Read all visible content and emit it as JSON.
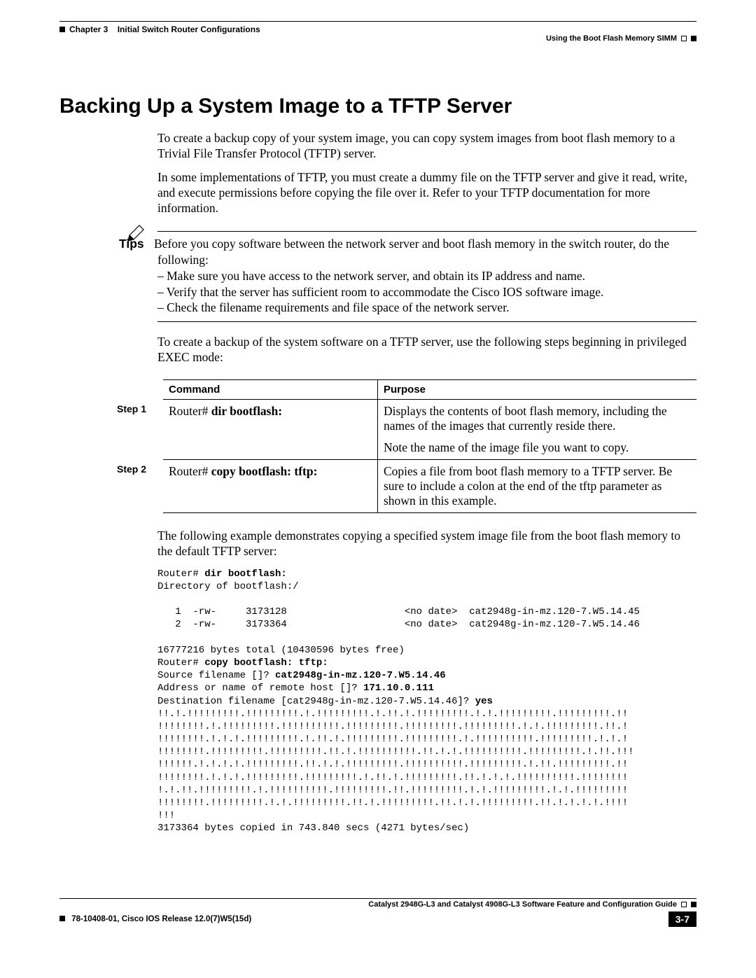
{
  "header": {
    "chapter": "Chapter 3",
    "chapter_title": "Initial Switch Router Configurations",
    "section": "Using the Boot Flash Memory SIMM"
  },
  "title": "Backing Up a System Image to a TFTP Server",
  "paras": {
    "p1": "To create a backup copy of your system image, you can copy system images from boot flash memory to a Trivial File Transfer Protocol (TFTP) server.",
    "p2": "In some implementations of TFTP, you must create a dummy file on the TFTP server and give it read, write, and execute permissions before copying the file over it. Refer to your TFTP documentation for more information.",
    "p3": "To create a backup of the system software on a TFTP server, use the following steps beginning in privileged EXEC mode:",
    "p4": "The following example demonstrates copying a specified system image file from the boot flash memory to the default TFTP server:"
  },
  "tips": {
    "label": "Tips",
    "intro": "Before you copy software between the network server and boot flash memory in the switch router, do the following:",
    "b1": "– Make sure you have access to the network server, and obtain its IP address and name.",
    "b2": "– Verify that the server has sufficient room to accommodate the Cisco IOS software image.",
    "b3": "– Check the filename requirements and file space of the network server."
  },
  "table": {
    "head_cmd": "Command",
    "head_purpose": "Purpose",
    "step1_label": "Step 1",
    "step1_prompt": "Router# ",
    "step1_cmd": "dir bootflash:",
    "step1_purpose_a": "Displays the contents of boot flash memory, including the names of the images that currently reside there.",
    "step1_purpose_b": "Note the name of the image file you want to copy.",
    "step2_label": "Step 2",
    "step2_prompt": "Router# ",
    "step2_cmd": "copy bootflash: tftp:",
    "step2_purpose": "Copies a file from boot flash memory to a TFTP server. Be sure to include a colon at the end of the tftp parameter as shown in this example."
  },
  "code": {
    "l1p": "Router# ",
    "l1b": "dir bootflash:",
    "l2": "Directory of bootflash:/",
    "l3": "",
    "l4": "   1  -rw-     3173128                    <no date>  cat2948g-in-mz.120-7.W5.14.45",
    "l5": "   2  -rw-     3173364                    <no date>  cat2948g-in-mz.120-7.W5.14.46",
    "l6": "",
    "l7": "16777216 bytes total (10430596 bytes free)",
    "l8p": "Router# ",
    "l8b": "copy bootflash: tftp:",
    "l9p": "Source filename []? ",
    "l9b": "cat2948g-in-mz.120-7.W5.14.46",
    "l10p": "Address or name of remote host []? ",
    "l10b": "171.10.0.111",
    "l11p": "Destination filename [cat2948g-in-mz.120-7.W5.14.46]? ",
    "l11b": "yes",
    "l12": "!!.!.!!!!!!!!!.!!!!!!!!!.!.!!!!!!!!!.!.!!.!.!!!!!!!!!.!.!.!!!!!!!!!.!!!!!!!!!.!!",
    "l13": "!!!!!!!!.!.!!!!!!!!!.!!!!!!!!!!.!!!!!!!!!.!!!!!!!!!.!!!!!!!!!.!.!.!!!!!!!!!.!!.!",
    "l14": "!!!!!!!!.!.!.!.!!!!!!!!!.!.!!.!.!!!!!!!!!.!!!!!!!!!.!.!!!!!!!!!!.!!!!!!!!!.!.!.!",
    "l15": "!!!!!!!!.!!!!!!!!!.!!!!!!!!!.!!.!.!!!!!!!!!!.!!.!.!.!!!!!!!!!!.!!!!!!!!!.!.!!.!!!",
    "l16": "!!!!!!.!.!.!.!.!!!!!!!!!.!!.!.!.!!!!!!!!!.!!!!!!!!!!.!!!!!!!!!.!.!!.!!!!!!!!!.!!",
    "l17": "!!!!!!!!.!.!.!.!!!!!!!!!.!!!!!!!!!.!.!!.!.!!!!!!!!!.!!.!.!.!.!!!!!!!!!!.!!!!!!!!",
    "l18": "!.!.!!.!!!!!!!!!.!.!!!!!!!!!!.!!!!!!!!!.!!.!!!!!!!!!.!.!.!!!!!!!!!.!.!.!!!!!!!!!",
    "l19": "!!!!!!!!.!!!!!!!!!.!.!.!!!!!!!!!.!!.!.!!!!!!!!!.!!.!.!.!!!!!!!!!.!!.!.!.!.!.!!!!",
    "l20": "!!!",
    "l21": "3173364 bytes copied in 743.840 secs (4271 bytes/sec)"
  },
  "footer": {
    "guide": "Catalyst 2948G-L3 and Catalyst 4908G-L3 Software Feature and Configuration Guide",
    "doc": "78-10408-01, Cisco IOS Release 12.0(7)W5(15d)",
    "pagenum": "3-7"
  }
}
